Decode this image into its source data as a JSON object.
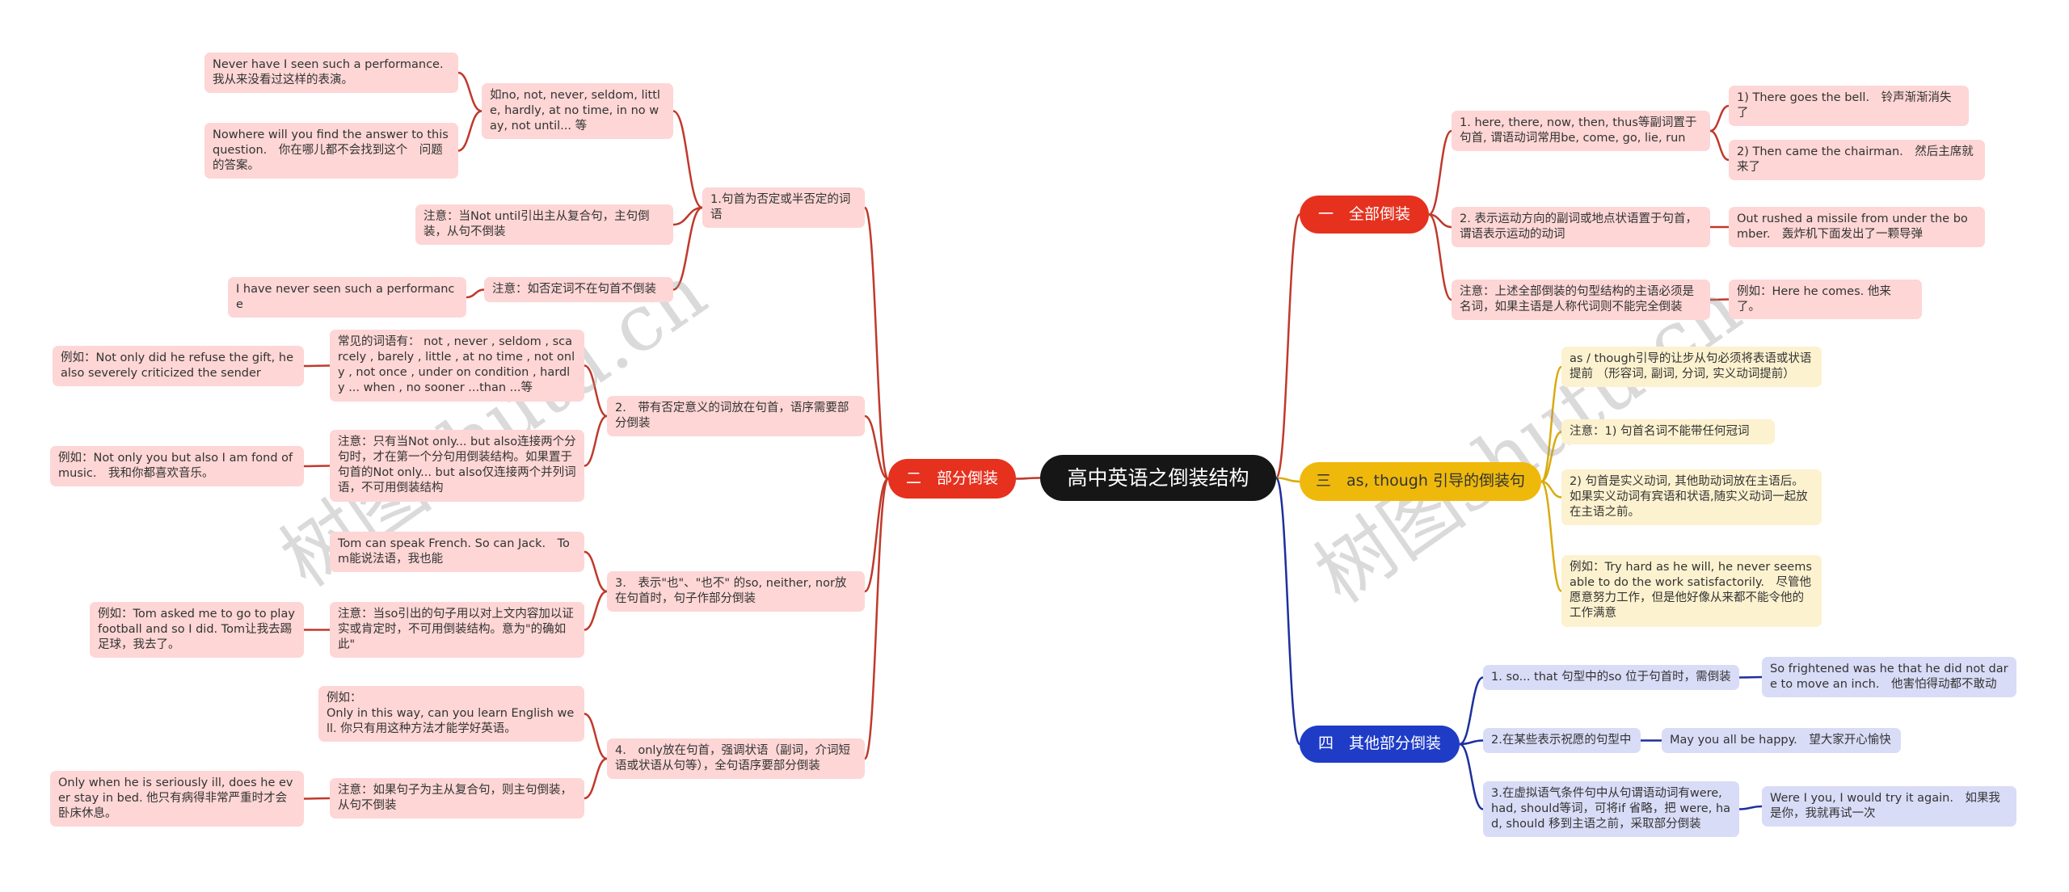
{
  "root": "高中英语之倒装结构",
  "watermark": "树图shutu.cn",
  "colors": {
    "red": "#e6311f",
    "red_line": "#c0392b",
    "yellow": "#efb90c",
    "yellow_line": "#d9ab10",
    "blue": "#1f3cc7",
    "blue_line": "#1d2f9e",
    "root": "#161616"
  },
  "b1": {
    "label": "一　全部倒装",
    "c1": "1. here, there, now, then, thus等副词置于句首, 谓语动词常用be, come, go, lie, run",
    "c1a": "1) There goes the bell.　铃声渐渐消失了",
    "c1b": "2) Then came the chairman.　然后主席就来了",
    "c2": "2. 表示运动方向的副词或地点状语置于句首，谓语表示运动的动词",
    "c2a": "Out rushed a missile from under the bomber.　轰炸机下面发出了一颗导弹",
    "c3": "注意：上述全部倒装的句型结构的主语必须是名词，如果主语是人称代词则不能完全倒装",
    "c3a": "例如：Here he comes. 他来了。"
  },
  "b2": {
    "label": "二　部分倒装",
    "l1": "1.句首为否定或半否定的词语",
    "l1a": "如no, not, never, seldom, little, hardly, at no time,  in no way, not until... 等",
    "l1a1": "Never have I seen such a performance. 我从来没看过这样的表演。",
    "l1a2": "Nowhere will you find the answer to this question.　你在哪儿都不会找到这个　问题的答案。",
    "l1b": "注意：当Not until引出主从复合句，主句倒装，从句不倒装",
    "l1c": "注意：如否定词不在句首不倒装",
    "l1c1": "I have never seen such a performance",
    "l2": "2.　带有否定意义的词放在句首，语序需要部分倒装",
    "l2a": "常见的词语有：  not , never ,   seldom , scarcely , barely , little , at no time , not only , not once , under on condition , hardly ... when , no sooner ...than ...等",
    "l2a1": "例如：Not only did he refuse the gift, he also severely criticized the sender",
    "l2b": "注意：只有当Not only... but also连接两个分句时，才在第一个分句用倒装结构。如果置于句首的Not only... but also仅连接两个并列词语，不可用倒装结构",
    "l2b1": "例如：Not only you but also I am fond of music.　我和你都喜欢音乐。",
    "l3": "3.　表示\"也\"、\"也不\" 的so, neither, nor放在句首时，句子作部分倒装",
    "l3a": "Tom can speak French. So can Jack.　Tom能说法语，我也能",
    "l3b": "注意：当so引出的句子用以对上文内容加以证实或肯定时，不可用倒装结构。意为\"的确如此\"",
    "l3b1": "例如：Tom asked me to go to play football and so I did. Tom让我去踢足球，我去了。",
    "l4": "4.　only放在句首，强调状语（副词，介词短语或状语从句等），全句语序要部分倒装",
    "l4a": "例如：\nOnly in this way, can you learn English well. 你只有用这种方法才能学好英语。",
    "l4b": "注意：如果句子为主从复合句，则主句倒装，从句不倒装",
    "l4b1": "Only when he is seriously ill, does he ever stay in bed. 他只有病得非常严重时才会卧床休息。"
  },
  "b3": {
    "label": "三　as, though 引导的倒装句",
    "t1": "as / though引导的让步从句必须将表语或状语提前 （形容词, 副词, 分词, 实义动词提前）",
    "t2": "注意：1) 句首名词不能带任何冠词",
    "t3": "2) 句首是实义动词, 其他助动词放在主语后。如果实义动词有宾语和状语,随实义动词一起放在主语之前。",
    "t4": "例如：Try hard as he will, he never seems able to do the work satisfactorily.　尽管他愿意努力工作，但是他好像从来都不能令他的工作满意"
  },
  "b4": {
    "label": "四　其他部分倒装",
    "f1": "1. so... that 句型中的so 位于句首时，需倒装",
    "f1a": "So frightened was he that he did not dare to move an inch.　他害怕得动都不敢动",
    "f2": "2.在某些表示祝愿的句型中",
    "f2a": "May you all be happy.　望大家开心愉快",
    "f3": "3.在虚拟语气条件句中从句谓语动词有were, had, should等词，可将if 省略，把 were, had, should 移到主语之前，采取部分倒装",
    "f3a": "Were I you, I would try it again.　如果我是你，我就再试一次"
  }
}
